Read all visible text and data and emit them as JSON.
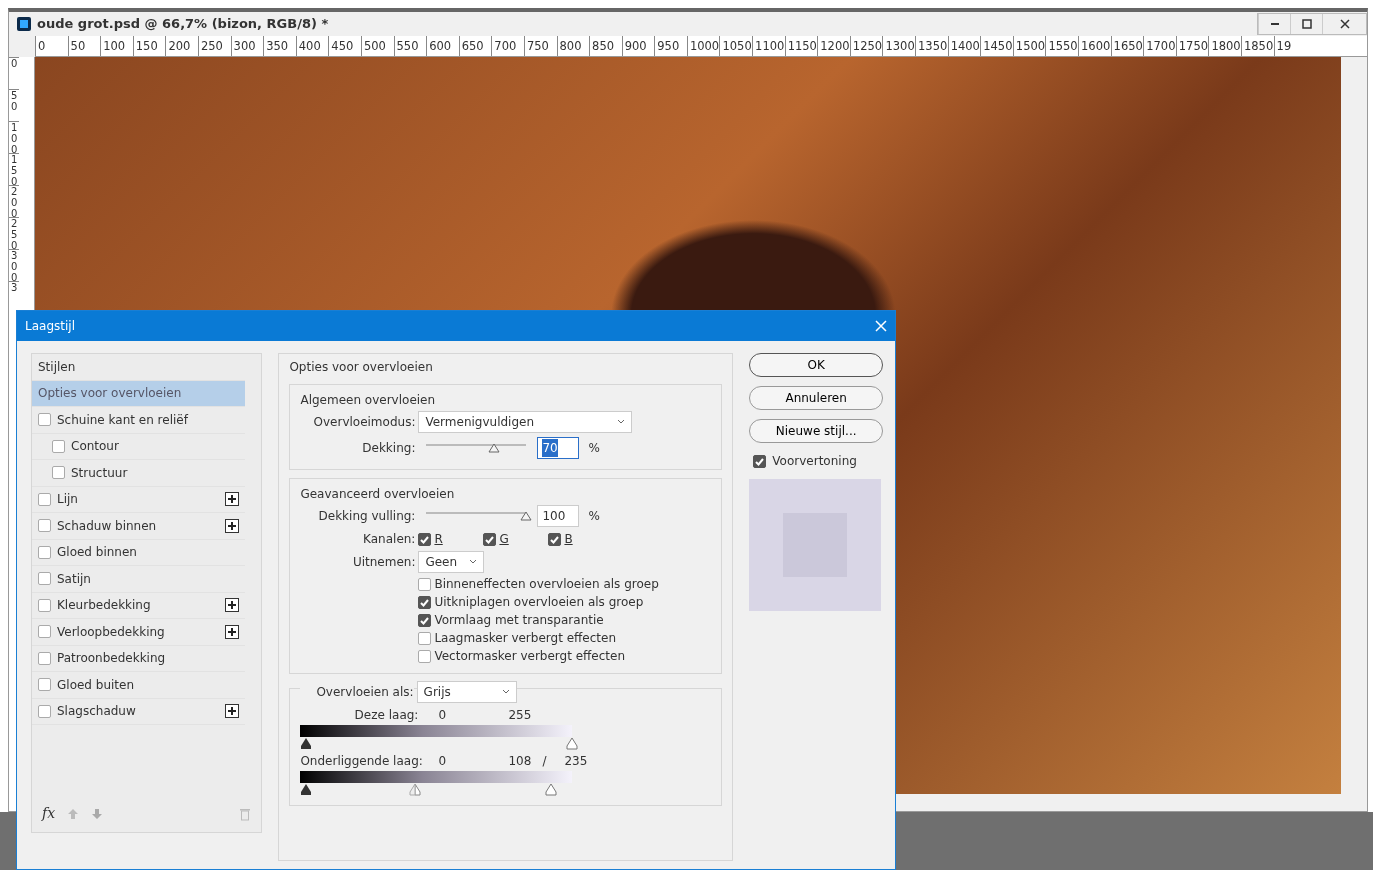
{
  "document": {
    "title": "oude grot.psd @ 66,7% (bizon, RGB/8) *",
    "ruler_h": [
      "0",
      "50",
      "100",
      "150",
      "200",
      "250",
      "300",
      "350",
      "400",
      "450",
      "500",
      "550",
      "600",
      "650",
      "700",
      "750",
      "800",
      "850",
      "900",
      "950",
      "1000",
      "1050",
      "1100",
      "1150",
      "1200",
      "1250",
      "1300",
      "1350",
      "1400",
      "1450",
      "1500",
      "1550",
      "1600",
      "1650",
      "1700",
      "1750",
      "1800",
      "1850",
      "19"
    ],
    "ruler_v": [
      "0",
      "50",
      "100",
      "150",
      "200",
      "250",
      "300",
      "3"
    ]
  },
  "dialog": {
    "title": "Laagstijl",
    "styles": {
      "heading": "Stijlen",
      "items": [
        {
          "label": "Opties voor overvloeien",
          "kind": "header",
          "selected": true
        },
        {
          "label": "Schuine kant en reliëf",
          "kind": "check",
          "checked": false,
          "selected": false,
          "addable": false,
          "children": [
            {
              "label": "Contour",
              "kind": "check",
              "checked": false,
              "selected": false,
              "addable": false
            },
            {
              "label": "Structuur",
              "kind": "check",
              "checked": false,
              "selected": false,
              "addable": false
            }
          ]
        },
        {
          "label": "Lijn",
          "kind": "check",
          "checked": false,
          "selected": false,
          "addable": true
        },
        {
          "label": "Schaduw binnen",
          "kind": "check",
          "checked": false,
          "selected": false,
          "addable": true
        },
        {
          "label": "Gloed binnen",
          "kind": "check",
          "checked": false,
          "selected": false,
          "addable": false
        },
        {
          "label": "Satijn",
          "kind": "check",
          "checked": false,
          "selected": false,
          "addable": false
        },
        {
          "label": "Kleurbedekking",
          "kind": "check",
          "checked": false,
          "selected": false,
          "addable": true
        },
        {
          "label": "Verloopbedekking",
          "kind": "check",
          "checked": false,
          "selected": false,
          "addable": true
        },
        {
          "label": "Patroonbedekking",
          "kind": "check",
          "checked": false,
          "selected": false,
          "addable": false
        },
        {
          "label": "Gloed buiten",
          "kind": "check",
          "checked": false,
          "selected": false,
          "addable": false
        },
        {
          "label": "Slagschaduw",
          "kind": "check",
          "checked": false,
          "selected": false,
          "addable": true
        }
      ],
      "footer": "fx"
    },
    "options": {
      "title": "Opties voor overvloeien",
      "general": {
        "title": "Algemeen overvloeien",
        "mode_label": "Overvloeimodus:",
        "mode": "Vermenigvuldigen",
        "opacity_label": "Dekking:",
        "opacity": {
          "level": 0.68,
          "value": "70",
          "highlighted": true,
          "unit": "%"
        }
      },
      "advanced": {
        "title": "Geavanceerd overvloeien",
        "fill_label": "Dekking vulling:",
        "fill": {
          "level": 1,
          "value": "100",
          "highlighted": false,
          "unit": "%"
        },
        "channels_label": "Kanalen:",
        "channels": [
          {
            "label": "R",
            "checked": true
          },
          {
            "label": "G",
            "checked": true
          },
          {
            "label": "B",
            "checked": true
          }
        ],
        "knockout_label": "Uitnemen:",
        "knockout": "Geen",
        "options": [
          {
            "label": "Binneneffecten overvloeien als groep",
            "checked": false
          },
          {
            "label": "Uitkniplagen overvloeien als groep",
            "checked": true
          },
          {
            "label": "Vormlaag met transparantie",
            "checked": true
          },
          {
            "label": "Laagmasker verbergt effecten",
            "checked": false
          },
          {
            "label": "Vectormasker verbergt effecten",
            "checked": false
          }
        ]
      },
      "blend_if": {
        "label": "Overvloeien als:",
        "value": "Grijs",
        "ranges": [
          {
            "label": "Deze laag:",
            "numbers": [
              "0",
              "255"
            ],
            "thumbs": [
              {
                "kind": "dark",
                "level": 0
              },
              {
                "kind": "light",
                "level": 1
              }
            ]
          },
          {
            "label": "Onderliggende laag:",
            "numbers": [
              "0",
              "108",
              "/",
              "235"
            ],
            "thumbs": [
              {
                "kind": "dark",
                "level": 0
              },
              {
                "kind": "split",
                "level": 0.42
              },
              {
                "kind": "light",
                "level": 0.92
              }
            ]
          }
        ]
      }
    },
    "buttons": [
      {
        "label": "OK",
        "default": true
      },
      {
        "label": "Annuleren",
        "default": false
      },
      {
        "label": "Nieuwe stijl...",
        "default": false
      }
    ],
    "preview": {
      "label": "Voorvertoning",
      "checked": true
    }
  }
}
